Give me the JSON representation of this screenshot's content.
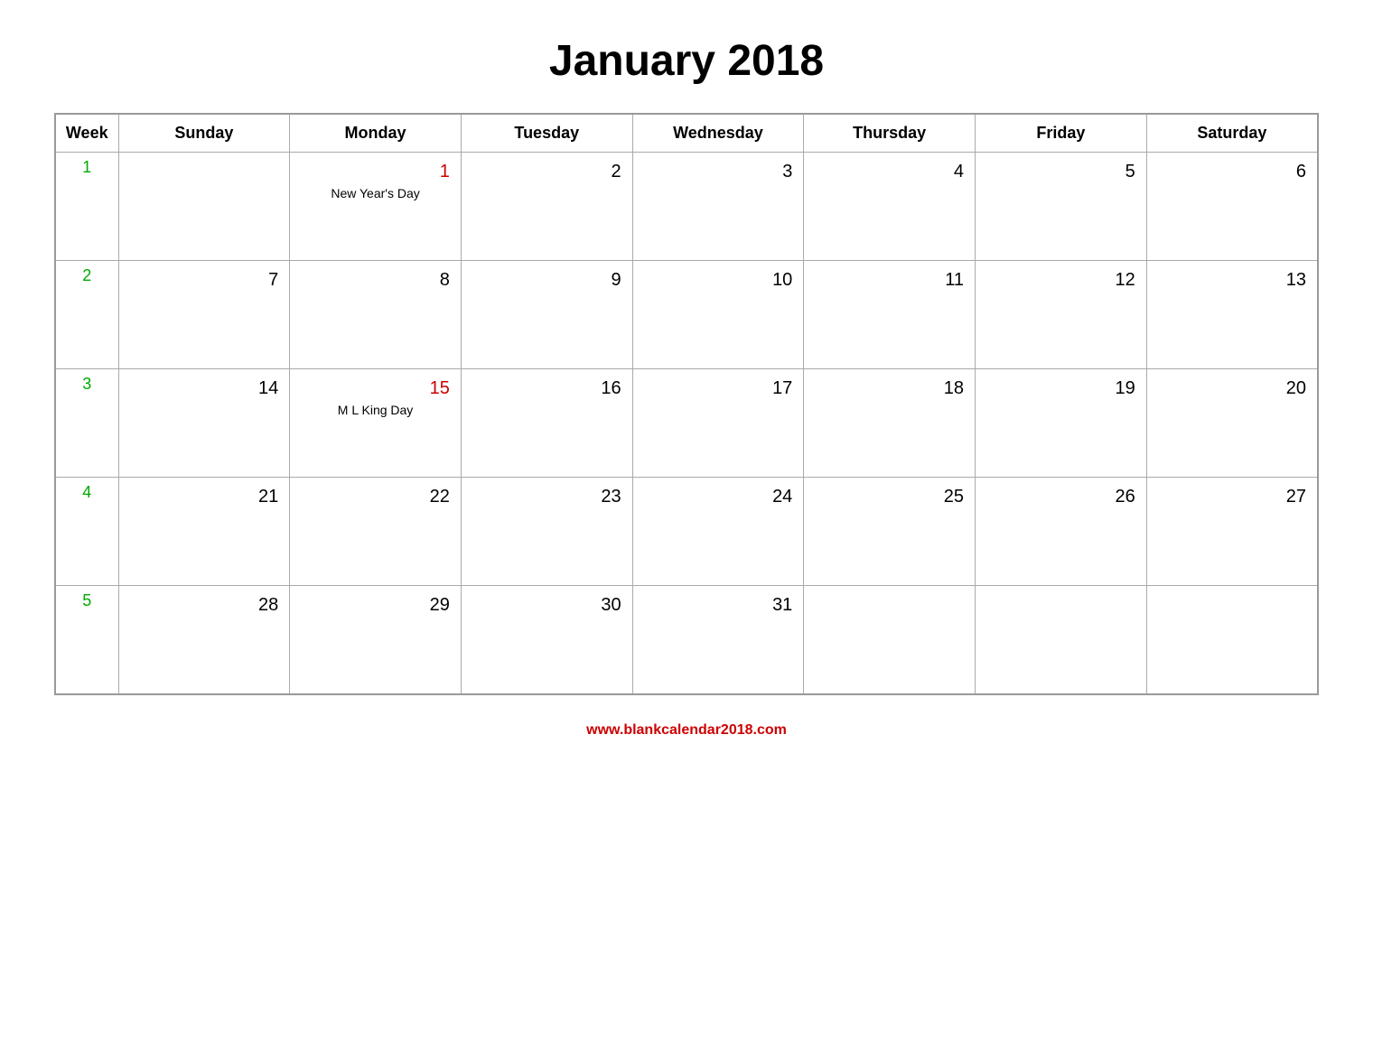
{
  "title": "January 2018",
  "headers": [
    "Week",
    "Sunday",
    "Monday",
    "Tuesday",
    "Wednesday",
    "Thursday",
    "Friday",
    "Saturday"
  ],
  "weeks": [
    {
      "week_num": "1",
      "days": [
        {
          "date": "",
          "label": "",
          "red": false,
          "empty": true
        },
        {
          "date": "1",
          "label": "New Year's Day",
          "red": true,
          "empty": false
        },
        {
          "date": "2",
          "label": "",
          "red": false,
          "empty": false
        },
        {
          "date": "3",
          "label": "",
          "red": false,
          "empty": false
        },
        {
          "date": "4",
          "label": "",
          "red": false,
          "empty": false
        },
        {
          "date": "5",
          "label": "",
          "red": false,
          "empty": false
        },
        {
          "date": "6",
          "label": "",
          "red": false,
          "empty": false
        }
      ]
    },
    {
      "week_num": "2",
      "days": [
        {
          "date": "7",
          "label": "",
          "red": false,
          "empty": false
        },
        {
          "date": "8",
          "label": "",
          "red": false,
          "empty": false
        },
        {
          "date": "9",
          "label": "",
          "red": false,
          "empty": false
        },
        {
          "date": "10",
          "label": "",
          "red": false,
          "empty": false
        },
        {
          "date": "11",
          "label": "",
          "red": false,
          "empty": false
        },
        {
          "date": "12",
          "label": "",
          "red": false,
          "empty": false
        },
        {
          "date": "13",
          "label": "",
          "red": false,
          "empty": false
        }
      ]
    },
    {
      "week_num": "3",
      "days": [
        {
          "date": "14",
          "label": "",
          "red": false,
          "empty": false
        },
        {
          "date": "15",
          "label": "M L King Day",
          "red": true,
          "empty": false
        },
        {
          "date": "16",
          "label": "",
          "red": false,
          "empty": false
        },
        {
          "date": "17",
          "label": "",
          "red": false,
          "empty": false
        },
        {
          "date": "18",
          "label": "",
          "red": false,
          "empty": false
        },
        {
          "date": "19",
          "label": "",
          "red": false,
          "empty": false
        },
        {
          "date": "20",
          "label": "",
          "red": false,
          "empty": false
        }
      ]
    },
    {
      "week_num": "4",
      "days": [
        {
          "date": "21",
          "label": "",
          "red": false,
          "empty": false
        },
        {
          "date": "22",
          "label": "",
          "red": false,
          "empty": false
        },
        {
          "date": "23",
          "label": "",
          "red": false,
          "empty": false
        },
        {
          "date": "24",
          "label": "",
          "red": false,
          "empty": false
        },
        {
          "date": "25",
          "label": "",
          "red": false,
          "empty": false
        },
        {
          "date": "26",
          "label": "",
          "red": false,
          "empty": false
        },
        {
          "date": "27",
          "label": "",
          "red": false,
          "empty": false
        }
      ]
    },
    {
      "week_num": "5",
      "days": [
        {
          "date": "28",
          "label": "",
          "red": false,
          "empty": false
        },
        {
          "date": "29",
          "label": "",
          "red": false,
          "empty": false
        },
        {
          "date": "30",
          "label": "",
          "red": false,
          "empty": false
        },
        {
          "date": "31",
          "label": "",
          "red": false,
          "empty": false
        },
        {
          "date": "",
          "label": "",
          "red": false,
          "empty": true
        },
        {
          "date": "",
          "label": "",
          "red": false,
          "empty": true
        },
        {
          "date": "",
          "label": "",
          "red": false,
          "empty": true
        }
      ]
    }
  ],
  "footer_url": "www.blankcalendar2018.com"
}
